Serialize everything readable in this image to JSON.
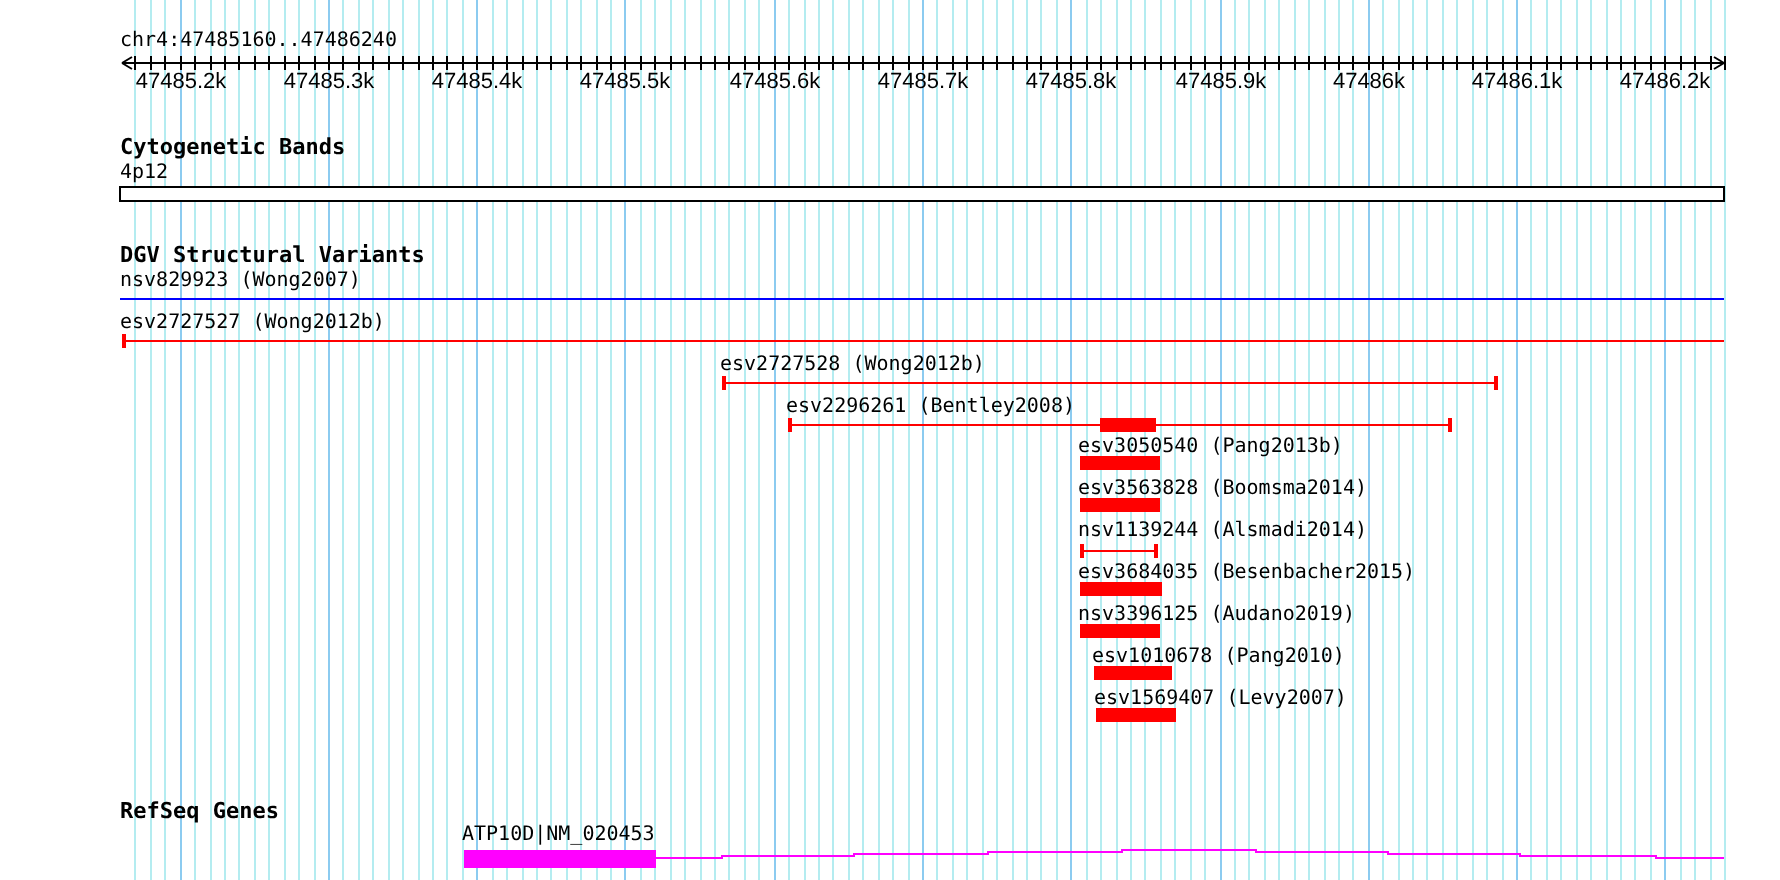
{
  "title": "chr4:47485160..47486240",
  "ruler": {
    "labels": [
      "47485.2k",
      "47485.3k",
      "47485.4k",
      "47485.5k",
      "47485.6k",
      "47485.7k",
      "47485.8k",
      "47485.9k",
      "47486k",
      "47486.1k",
      "47486.2k"
    ]
  },
  "cytogenetic_bands": {
    "title": "Cytogenetic Bands",
    "band": "4p12"
  },
  "dgv_structural_variants": {
    "title": "DGV Structural Variants",
    "variants": [
      {
        "label": "nsv829923 (Wong2007)",
        "kind": "line",
        "color": "#0000ff"
      },
      {
        "label": "esv2727527 (Wong2012b)",
        "kind": "span",
        "color": "#ff0000"
      },
      {
        "label": "esv2727528 (Wong2012b)",
        "kind": "span",
        "color": "#ff0000"
      },
      {
        "label": "esv2296261 (Bentley2008)",
        "kind": "span",
        "color": "#ff0000"
      },
      {
        "kind": "bar",
        "color": "#ff0000"
      },
      {
        "label": "esv3050540 (Pang2013b)",
        "kind": "bar",
        "color": "#ff0000"
      },
      {
        "label": "esv3563828 (Boomsma2014)",
        "kind": "bar",
        "color": "#ff0000"
      },
      {
        "label": "nsv1139244 (Alsmadi2014)",
        "kind": "span",
        "color": "#ff0000"
      },
      {
        "label": "esv3684035 (Besenbacher2015)",
        "kind": "bar",
        "color": "#ff0000"
      },
      {
        "label": "nsv3396125 (Audano2019)",
        "kind": "bar",
        "color": "#ff0000"
      },
      {
        "label": "esv1010678 (Pang2010)",
        "kind": "bar",
        "color": "#ff0000"
      },
      {
        "label": "esv1569407 (Levy2007)",
        "kind": "bar",
        "color": "#ff0000"
      }
    ]
  },
  "refseq_genes": {
    "title": "RefSeq Genes",
    "genes": [
      {
        "label": "ATP10D|NM_020453"
      }
    ]
  }
}
